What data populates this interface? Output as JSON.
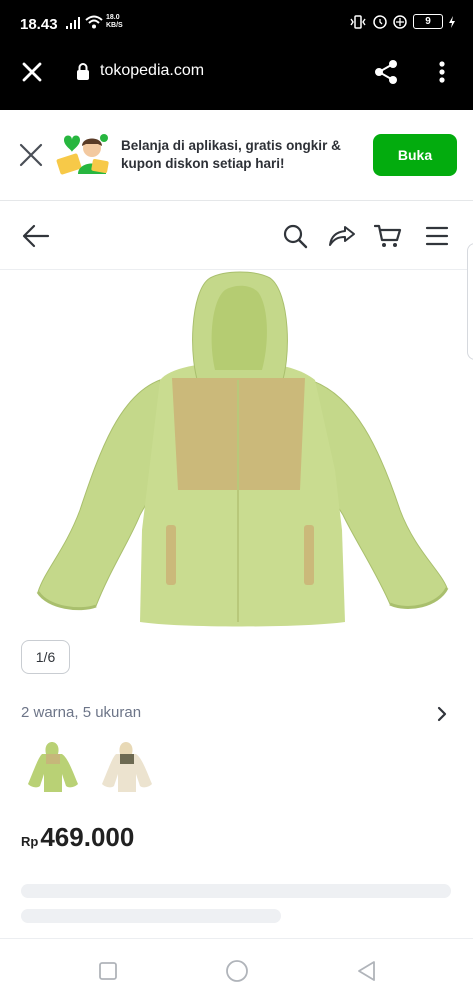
{
  "status_bar": {
    "time": "18.43",
    "net_speed_value": "18.0",
    "net_speed_unit": "KB/S",
    "battery": "9"
  },
  "browser": {
    "url": "tokopedia.com"
  },
  "app_banner": {
    "text": "Belanja di aplikasi, gratis ongkir & kupon diskon setiap hari!",
    "button_label": "Buka",
    "accent_color": "#03ac0e"
  },
  "product": {
    "image_counter": "1/6",
    "variants_summary": "2 warna, 5 ukuran",
    "price_currency": "Rp",
    "price_value": "469.000"
  }
}
